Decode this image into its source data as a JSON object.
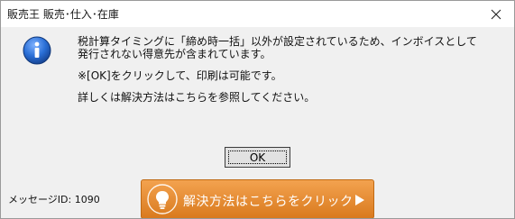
{
  "window": {
    "title": "販売王 販売･仕入･在庫",
    "close_glyph": "✕"
  },
  "message": {
    "icon": "info-icon",
    "lines": [
      "税計算タイミングに「締め時一括」以外が設定されているため、インボイスとして",
      "発行されない得意先が含まれています。",
      "※[OK]をクリックして、印刷は可能です。",
      "詳しくは解決方法はこちらを参照してください。"
    ]
  },
  "buttons": {
    "ok_label": "OK"
  },
  "footer": {
    "message_id": "メッセージID: 1090",
    "help_label": "解決方法はこちらをクリック",
    "help_icon": "lightbulb-icon",
    "help_arrow": "play-arrow-icon"
  },
  "colors": {
    "help_button": "#e8902f",
    "info_icon": "#1d5fc4"
  }
}
